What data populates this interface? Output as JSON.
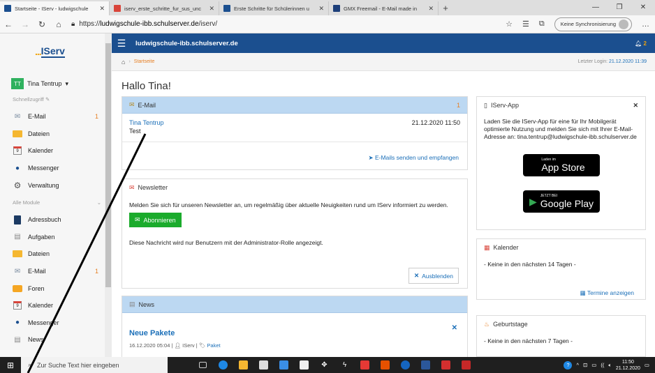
{
  "browser": {
    "tabs": [
      {
        "title": "Startseite - IServ - ludwigschule",
        "active": true,
        "color": "#1b4f8f"
      },
      {
        "title": "iserv_erste_schritte_fur_sus_unc",
        "active": false,
        "color": "#d9453b"
      },
      {
        "title": "Erste Schritte für Schülerinnen u",
        "active": false,
        "color": "#1b4f8f"
      },
      {
        "title": "GMX Freemail - E-Mail made in",
        "active": false,
        "color": "#1d3f7a"
      }
    ],
    "url_scheme": "https://",
    "url_host": "ludwigschule-ibb.schulserver.de",
    "url_path": "/iserv/",
    "sync_label": "Keine Synchronisierung"
  },
  "sidebar": {
    "logo": "IServ",
    "user": {
      "initials": "TT",
      "name": "Tina Tentrup"
    },
    "quick_label": "Schnellzugriff",
    "quick_items": [
      {
        "label": "E-Mail",
        "count": "1",
        "icon": "mail-icon"
      },
      {
        "label": "Dateien",
        "count": "",
        "icon": "folder-icon"
      },
      {
        "label": "Kalender",
        "count": "",
        "icon": "calendar-icon"
      },
      {
        "label": "Messenger",
        "count": "",
        "icon": "messenger-icon"
      },
      {
        "label": "Verwaltung",
        "count": "",
        "icon": "gear-icon"
      }
    ],
    "modules_label": "Alle Module",
    "module_items": [
      {
        "label": "Adressbuch",
        "count": "",
        "icon": "addressbook-icon"
      },
      {
        "label": "Aufgaben",
        "count": "",
        "icon": "tasks-icon"
      },
      {
        "label": "Dateien",
        "count": "",
        "icon": "folder-icon"
      },
      {
        "label": "E-Mail",
        "count": "1",
        "icon": "mail-icon"
      },
      {
        "label": "Foren",
        "count": "",
        "icon": "forum-icon"
      },
      {
        "label": "Kalender",
        "count": "",
        "icon": "calendar-icon"
      },
      {
        "label": "Messenger",
        "count": "",
        "icon": "messenger-icon"
      },
      {
        "label": "News",
        "count": "",
        "icon": "news-icon"
      }
    ]
  },
  "header": {
    "domain": "ludwigschule-ibb.schulserver.de",
    "notifications": "2",
    "breadcrumb": "Startseite",
    "last_login_label": "Letzter Login:",
    "last_login": "21.12.2020 11:39"
  },
  "main": {
    "greeting": "Hallo Tina!",
    "email_panel": {
      "title": "E-Mail",
      "count": "1",
      "sender": "Tina Tentrup",
      "subject": "Test",
      "date": "21.12.2020 11:50",
      "action": "E-Mails senden und empfangen"
    },
    "newsletter_panel": {
      "title": "Newsletter",
      "text": "Melden Sie sich für unseren Newsletter an, um regelmäßig über aktuelle Neuigkeiten rund um IServ informiert zu werden.",
      "subscribe": "Abonnieren",
      "admin_note": "Diese Nachricht wird nur Benutzern mit der Administrator-Rolle angezeigt.",
      "hide": "Ausblenden"
    },
    "news_panel": {
      "title": "News",
      "headline": "Neue Pakete",
      "date": "16.12.2020 05:04",
      "author": "IServ",
      "tag": "Paket"
    }
  },
  "right": {
    "app_panel": {
      "title": "IServ-App",
      "text": "Laden Sie die IServ-App für eine für Ihr Mobilgerät optimierte Nutzung und melden Sie sich mit Ihrer E-Mail-Adresse an: tina.tentrup@ludwigschule-ibb.schulserver.de",
      "appstore_small": "Laden im",
      "appstore": "App Store",
      "play_small": "JETZT BEI",
      "play": "Google Play"
    },
    "calendar_panel": {
      "title": "Kalender",
      "text": "- Keine in den nächsten 14 Tagen -",
      "action": "Termine anzeigen"
    },
    "birthday_panel": {
      "title": "Geburtstage",
      "text": "- Keine in den nächsten 7 Tagen -"
    }
  },
  "taskbar": {
    "search_placeholder": "Zur Suche Text hier eingeben",
    "time": "11:50",
    "date": "21.12.2020"
  },
  "colors": {
    "brand": "#1b4f8f",
    "accent": "#e67e22",
    "success": "#1bab2c",
    "panel_head": "#bcd8f2"
  }
}
